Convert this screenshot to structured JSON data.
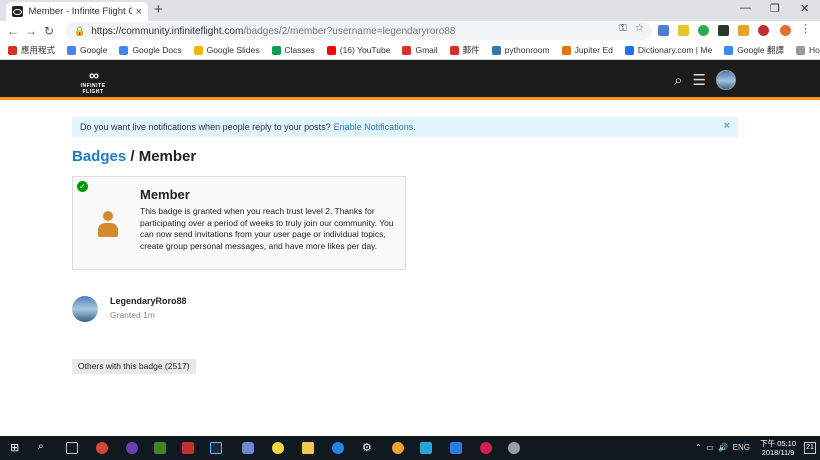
{
  "browser": {
    "tab_title": "Member - Infinite Flight Comm",
    "tab_close": "×",
    "new_tab": "+",
    "window_controls": [
      "—",
      "❐",
      "✕"
    ],
    "url_domain": "https://community.infiniteflight.com",
    "url_path": "/badges/2/member?username=legendaryroro88",
    "bookmarks": [
      {
        "label": "應用程式",
        "color": "#d93025"
      },
      {
        "label": "Google",
        "color": "#4285f4"
      },
      {
        "label": "Google Docs",
        "color": "#4285f4"
      },
      {
        "label": "Google Slides",
        "color": "#f4b400"
      },
      {
        "label": "Classes",
        "color": "#0f9d58"
      },
      {
        "label": "(16) YouTube",
        "color": "#ff0000"
      },
      {
        "label": "Gmail",
        "color": "#d93025"
      },
      {
        "label": "郵件",
        "color": "#d93025"
      },
      {
        "label": "pythonroom",
        "color": "#3776ab"
      },
      {
        "label": "Jupiter Ed",
        "color": "#e37400"
      },
      {
        "label": "Dictionary.com | Me",
        "color": "#1a73e8"
      },
      {
        "label": "Google 翻譯",
        "color": "#4285f4"
      },
      {
        "label": "Home",
        "color": "#999999"
      }
    ]
  },
  "site": {
    "logo_text": "INFINITE FLIGHT",
    "logo_mark": "∞"
  },
  "notice": {
    "text": "Do you want live notifications when people reply to your posts?",
    "link": "Enable Notifications.",
    "close": "×"
  },
  "page": {
    "breadcrumb": "Badges",
    "separator": " / ",
    "title": "Member"
  },
  "badge": {
    "name": "Member",
    "description": "This badge is granted when you reach trust level 2. Thanks for participating over a period of weeks to truly join our community. You can now send invitations from your user page or individual topics, create group personal messages, and have more likes per day."
  },
  "grantee": {
    "username": "LegendaryRoro88",
    "granted": "Granted 1m"
  },
  "others_button": "Others with this badge (2517)",
  "taskbar": {
    "lang": "ENG",
    "time": "下午 05:10",
    "date": "2018/11/9",
    "notifications": "21"
  }
}
